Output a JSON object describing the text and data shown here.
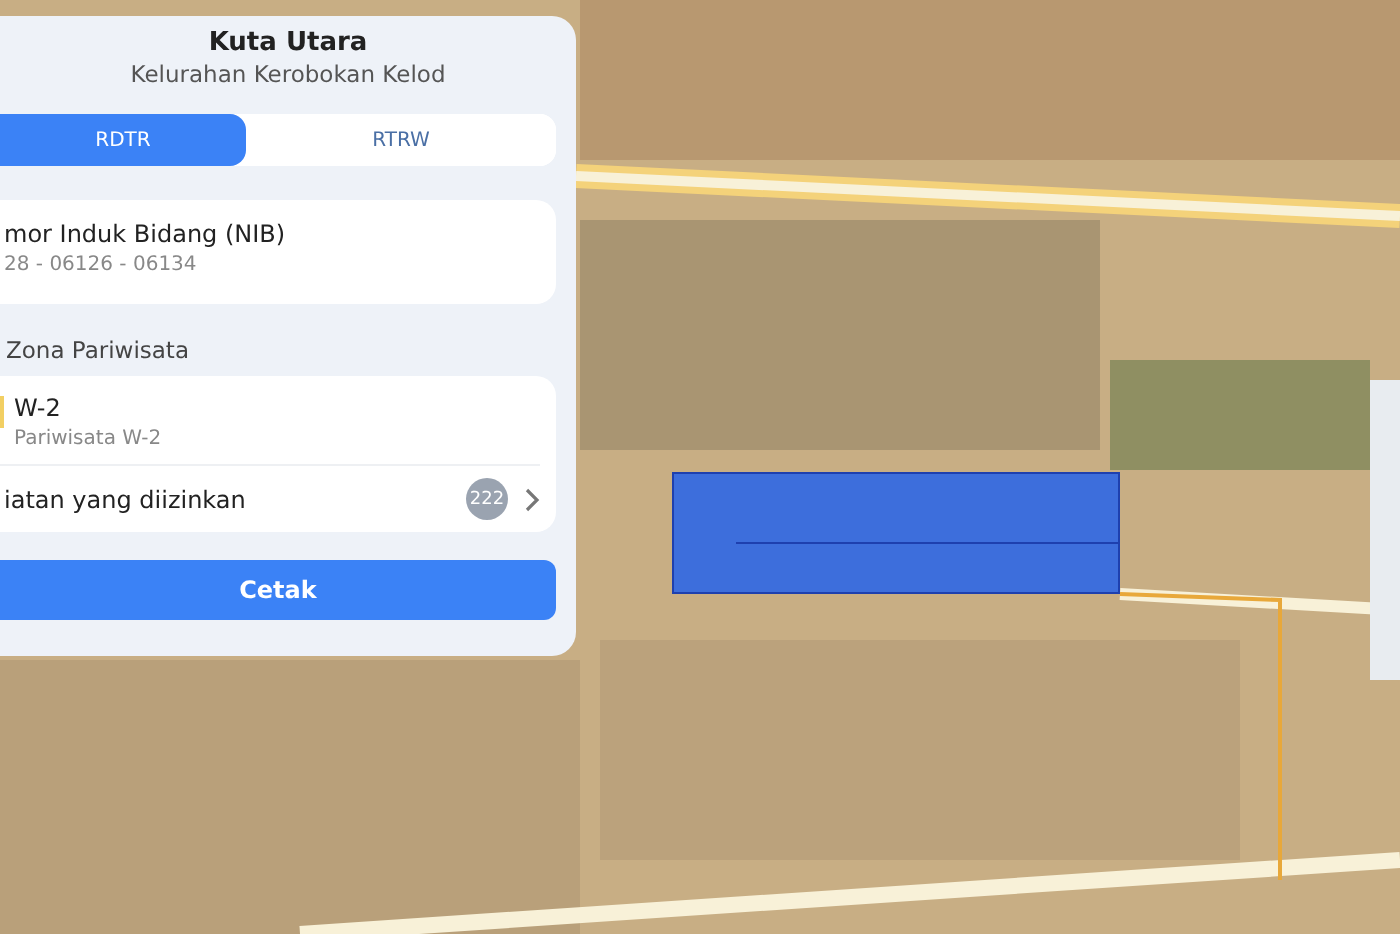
{
  "header": {
    "title": "Kuta Utara",
    "subtitle": "Kelurahan Kerobokan Kelod"
  },
  "tabs": [
    {
      "label": "RDTR",
      "selected": true
    },
    {
      "label": "RTRW",
      "selected": false
    }
  ],
  "parcel_card": {
    "label": "mor Induk Bidang (NIB)",
    "value": "28 - 06126 - 06134"
  },
  "zone": {
    "heading": "Zona Pariwisata",
    "code": "W-2",
    "name": "Pariwisata W-2"
  },
  "activities": {
    "label": "iatan yang diizinkan",
    "count": "222"
  },
  "print_button": "Cetak"
}
